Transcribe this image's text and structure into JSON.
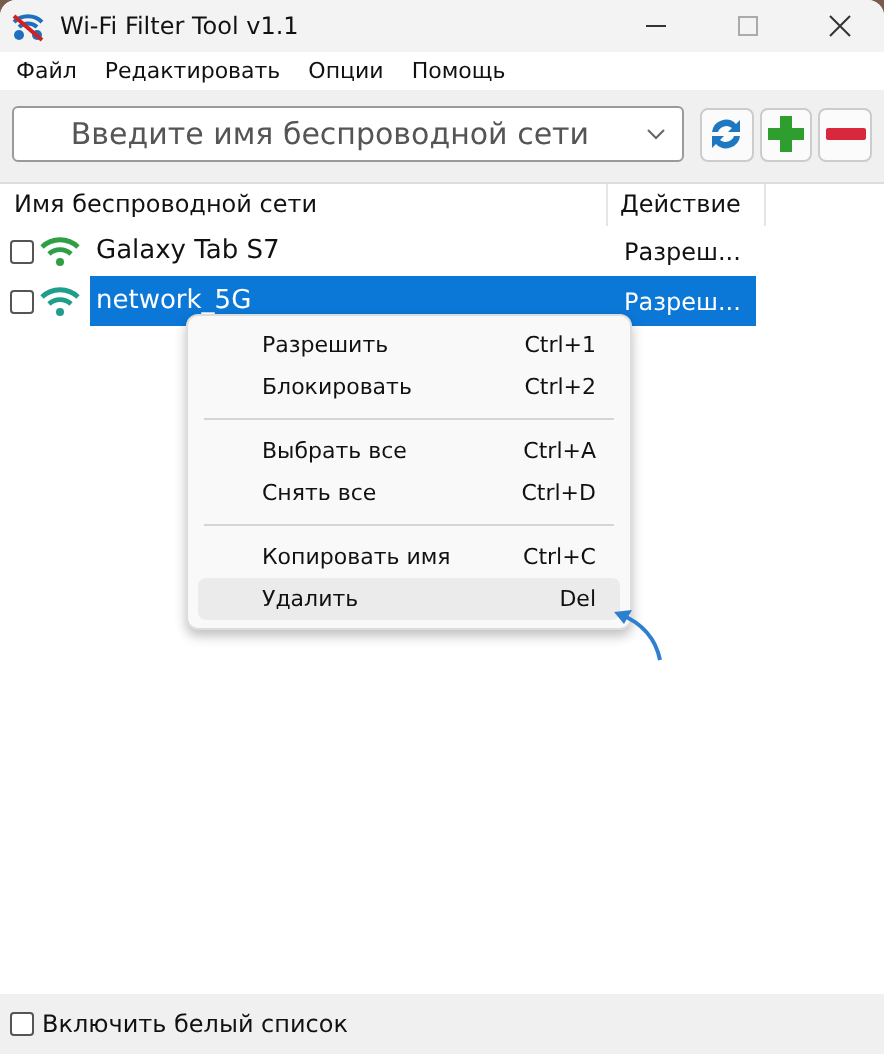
{
  "window": {
    "title": "Wi-Fi Filter Tool v1.1"
  },
  "menu_bar": [
    "Файл",
    "Редактировать",
    "Опции",
    "Помощь"
  ],
  "search": {
    "placeholder": "Введите имя беспроводной сети"
  },
  "table": {
    "columns": [
      "Имя беспроводной сети",
      "Действие"
    ],
    "rows": [
      {
        "checked": false,
        "selected": false,
        "color": "#2ea043",
        "name": "Galaxy Tab S7",
        "action": "Разреш..."
      },
      {
        "checked": false,
        "selected": true,
        "color": "#1f9e8c",
        "name": "network_5G",
        "action": "Разреш..."
      }
    ]
  },
  "context_menu": {
    "groups": [
      [
        {
          "label": "Разрешить",
          "shortcut": "Ctrl+1",
          "highlighted": false
        },
        {
          "label": "Блокировать",
          "shortcut": "Ctrl+2",
          "highlighted": false
        }
      ],
      [
        {
          "label": "Выбрать все",
          "shortcut": "Ctrl+A",
          "highlighted": false
        },
        {
          "label": "Снять все",
          "shortcut": "Ctrl+D",
          "highlighted": false
        }
      ],
      [
        {
          "label": "Копировать имя",
          "shortcut": "Ctrl+C",
          "highlighted": false
        },
        {
          "label": "Удалить",
          "shortcut": "Del",
          "highlighted": true
        }
      ]
    ]
  },
  "whitelist": {
    "label": "Включить белый список",
    "checked": false
  }
}
